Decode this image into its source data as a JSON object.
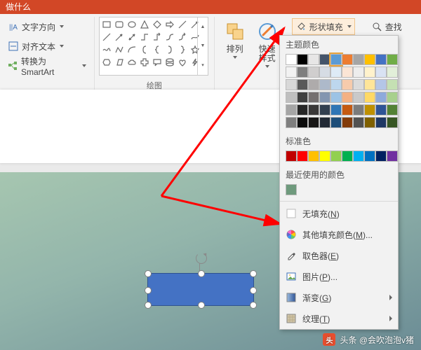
{
  "title_bar": "做什么",
  "text_group": {
    "text_direction": "文字方向",
    "align_text": "对齐文本",
    "convert_smartart": "转换为 SmartArt"
  },
  "group_labels": {
    "drawing": "绘图"
  },
  "big_buttons": {
    "arrange": "排列",
    "quick_styles": "快速样式"
  },
  "format": {
    "shape_fill": "形状填充",
    "find": "查找"
  },
  "dropdown": {
    "theme_colors": "主题颜色",
    "standard_colors": "标准色",
    "recent_colors": "最近使用的颜色",
    "no_fill": "无填充",
    "no_fill_key": "N",
    "more_colors": "其他填充颜色",
    "more_colors_key": "M",
    "eyedropper": "取色器",
    "eyedropper_key": "E",
    "picture": "图片",
    "picture_key": "P",
    "gradient": "渐变",
    "gradient_key": "G",
    "texture": "纹理",
    "texture_key": "T",
    "theme_palette": [
      [
        "#ffffff",
        "#000000",
        "#e7e6e6",
        "#44546a",
        "#5b9bd5",
        "#ed7d31",
        "#a5a5a5",
        "#ffc000",
        "#4472c4",
        "#70ad47"
      ],
      [
        "#f2f2f2",
        "#7f7f7f",
        "#d0cece",
        "#d6dce4",
        "#deebf6",
        "#fbe5d5",
        "#ededed",
        "#fff2cc",
        "#d9e2f3",
        "#e2efd9"
      ],
      [
        "#d8d8d8",
        "#595959",
        "#aeabab",
        "#adb9ca",
        "#bdd7ee",
        "#f7cbac",
        "#dbdbdb",
        "#fee599",
        "#b4c6e7",
        "#c5e0b3"
      ],
      [
        "#bfbfbf",
        "#3f3f3f",
        "#757070",
        "#8496b0",
        "#9cc3e5",
        "#f4b183",
        "#c9c9c9",
        "#ffd965",
        "#8eaadb",
        "#a8d08d"
      ],
      [
        "#a5a5a5",
        "#262626",
        "#3a3838",
        "#323f4f",
        "#2e75b5",
        "#c55a11",
        "#7b7b7b",
        "#bf9000",
        "#2f5496",
        "#538135"
      ],
      [
        "#7f7f7f",
        "#0c0c0c",
        "#171616",
        "#222a35",
        "#1e4e79",
        "#833c0b",
        "#525252",
        "#7f6000",
        "#1f3864",
        "#375623"
      ]
    ],
    "standard_palette": [
      "#c00000",
      "#ff0000",
      "#ffc000",
      "#ffff00",
      "#92d050",
      "#00b050",
      "#00b0f0",
      "#0070c0",
      "#002060",
      "#7030a0"
    ],
    "recent_palette": [
      "#6f9a7d"
    ],
    "selected_index": "0,4"
  },
  "credit": {
    "prefix": "头条",
    "author": "@会吹泡泡v猪"
  }
}
